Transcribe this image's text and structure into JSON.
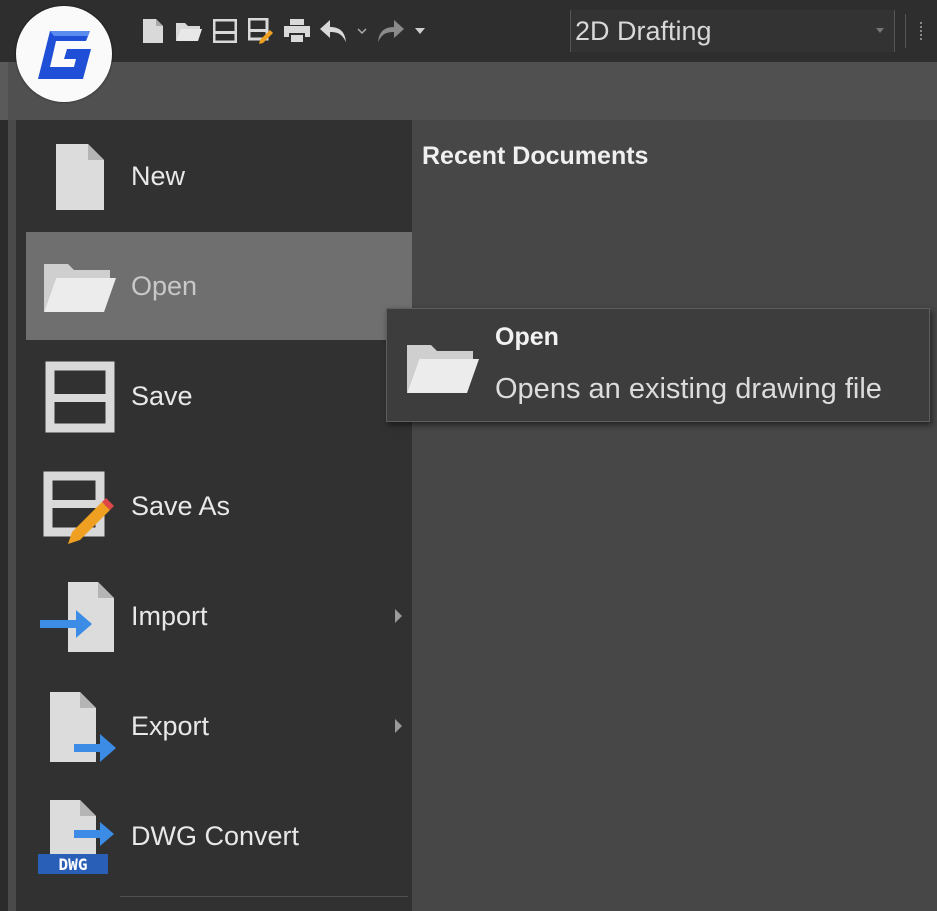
{
  "titlebar": {
    "workspace": "2D Drafting",
    "qat_icons": [
      "new-file-icon",
      "open-folder-icon",
      "save-icon",
      "save-as-icon",
      "print-icon",
      "undo-icon",
      "redo-icon"
    ]
  },
  "menu": {
    "items": [
      {
        "label": "New",
        "icon": "new-file-icon",
        "has_submenu": false
      },
      {
        "label": "Open",
        "icon": "open-folder-icon",
        "has_submenu": false,
        "active": true
      },
      {
        "label": "Save",
        "icon": "save-icon",
        "has_submenu": false
      },
      {
        "label": "Save As",
        "icon": "save-as-icon",
        "has_submenu": false
      },
      {
        "label": "Import",
        "icon": "import-icon",
        "has_submenu": true
      },
      {
        "label": "Export",
        "icon": "export-icon",
        "has_submenu": true
      },
      {
        "label": "DWG Convert",
        "icon": "dwg-convert-icon",
        "has_submenu": false
      }
    ]
  },
  "recent": {
    "title": "Recent Documents"
  },
  "tooltip": {
    "title": "Open",
    "description": "Opens an existing drawing file"
  },
  "colors": {
    "accent_blue": "#3c8ce6",
    "pencil_orange": "#f0a020",
    "logo_blue": "#1f4fd6",
    "active_item": "#6f6f6f"
  }
}
